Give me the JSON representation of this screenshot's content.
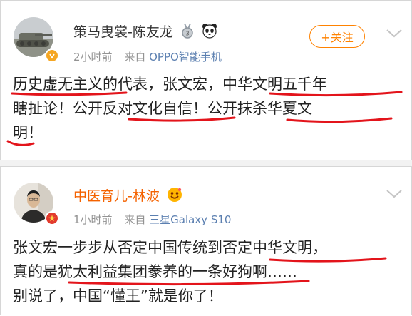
{
  "post1": {
    "username": "策马曳裳-陈友龙",
    "time": "2小时前",
    "from_label": "来自",
    "source": "OPPO智能手机",
    "follow_label": "+关注",
    "lines": [
      "历史虚无主义的代表，张文宏，中华文明五千年",
      "瞎扯论！公开反对文化自信！公开抹杀华夏文",
      "明！"
    ]
  },
  "post2": {
    "username": "中医育儿-林波",
    "time": "1小时前",
    "from_label": "来自",
    "source": "三星Galaxy S10",
    "lines": [
      "张文宏一步步从否定中国传统到否定中华文明，",
      "真的是犹太利益集团豢养的一条好狗啊……",
      "别说了，中国“懂王”就是你了！"
    ]
  },
  "colors": {
    "accent": "#ff8200",
    "link": "#5b7fb0",
    "annotation": "#e3141b",
    "username_orange": "#f46200"
  },
  "icons": [
    "medal-icon",
    "panda-icon",
    "verified-gold-icon",
    "verified-red-icon",
    "smile-badge-icon",
    "chevron-down-icon"
  ]
}
